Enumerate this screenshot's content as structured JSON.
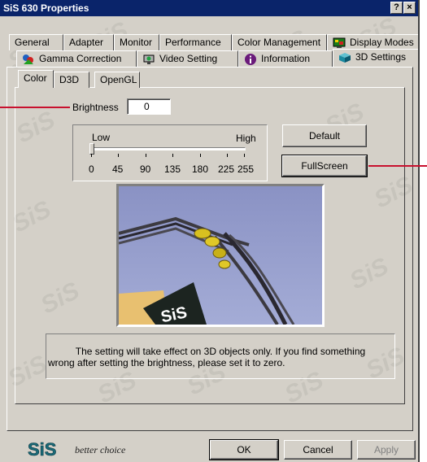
{
  "window": {
    "title": "SiS 630 Properties",
    "help_glyph": "?",
    "close_glyph": "×"
  },
  "tabs_row1": [
    "General",
    "Adapter",
    "Monitor",
    "Performance",
    "Color Management",
    "Display Modes"
  ],
  "tabs_row2": [
    "Gamma Correction",
    "Video Setting",
    "Information",
    "3D Settings"
  ],
  "subtabs": [
    "Color",
    "D3D",
    "OpenGL"
  ],
  "brightness": {
    "label": "Brightness",
    "value": "0",
    "level": 0
  },
  "slider": {
    "low_label": "Low",
    "high_label": "High",
    "ticks": [
      "0",
      "45",
      "90",
      "135",
      "180",
      "225",
      "255"
    ]
  },
  "buttons": {
    "default": "Default",
    "fullscreen": "FullScreen",
    "ok": "OK",
    "cancel": "Cancel",
    "apply": "Apply"
  },
  "note": {
    "line1": "The setting will take effect on 3D objects only.  If you find something",
    "line2": "wrong after setting the brightness, please set it to zero."
  },
  "preview": {
    "sign_text": "SiS"
  },
  "footer": {
    "logo": "SiS",
    "tagline": "better choice"
  },
  "colors": {
    "titlebar": "#0a246a",
    "face": "#d4d0c8",
    "annotation_line": "#c8102e",
    "sky": "#8e98c8"
  },
  "icons": [
    "gamma-icon",
    "video-setting-icon",
    "information-icon",
    "3d-cube-icon",
    "display-modes-icon"
  ]
}
